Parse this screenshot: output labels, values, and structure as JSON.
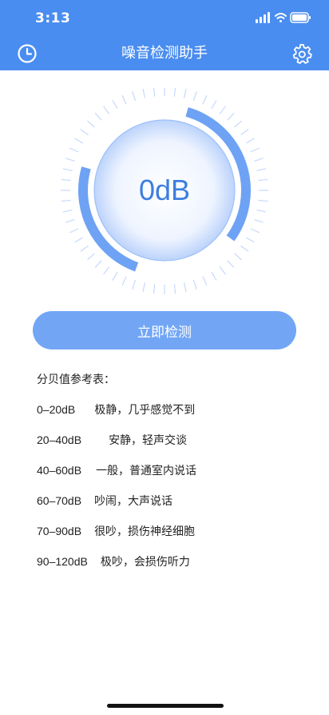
{
  "status_bar": {
    "time": "3:13"
  },
  "header": {
    "title": "噪音检测助手",
    "left_icon": "history-clock-icon",
    "right_icon": "settings-gear-icon"
  },
  "meter": {
    "value": "0dB",
    "level_fraction": 0.0
  },
  "actions": {
    "detect_label": "立即检测"
  },
  "reference": {
    "title": "分贝值参考表：",
    "rows": [
      {
        "range": "0–20dB",
        "desc": "极静，几乎感觉不到"
      },
      {
        "range": "20–40dB",
        "desc": "安静，轻声交谈"
      },
      {
        "range": "40–60dB",
        "desc": "一般，普通室内说话"
      },
      {
        "range": "60–70dB",
        "desc": "吵闹，大声说话"
      },
      {
        "range": "70–90dB",
        "desc": "很吵，损伤神经细胞"
      },
      {
        "range": "90–120dB",
        "desc": "极吵，会损伤听力"
      }
    ]
  },
  "colors": {
    "brand": "#4a8df0",
    "button": "#72a6f5",
    "value_text": "#3d7ee0"
  }
}
